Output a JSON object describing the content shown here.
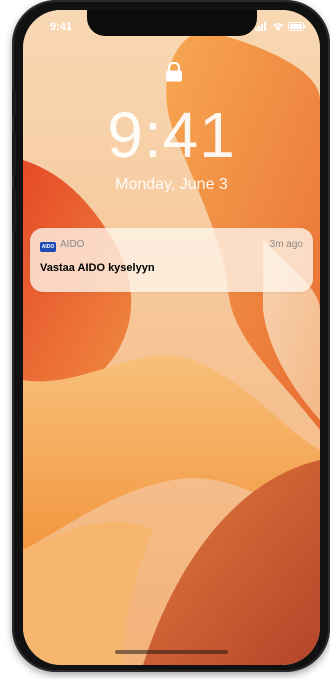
{
  "status_bar": {
    "time": "9:41",
    "icons": [
      "signal-icon",
      "wifi-icon",
      "battery-icon"
    ]
  },
  "lock_screen": {
    "lock_icon": "lock-icon",
    "time": "9:41",
    "date": "Monday, June 3"
  },
  "notification": {
    "app_icon_text": "AIDO",
    "app_name": "AIDO",
    "time_ago": "3m ago",
    "title": "Vastaa AIDO kyselyyn"
  },
  "colors": {
    "wallpaper_light": "#f7d0a8",
    "wallpaper_orange": "#f39a3a",
    "wallpaper_red": "#d94b2e",
    "wallpaper_dark": "#b84a2e",
    "notification_bg": "#fff6ec"
  }
}
